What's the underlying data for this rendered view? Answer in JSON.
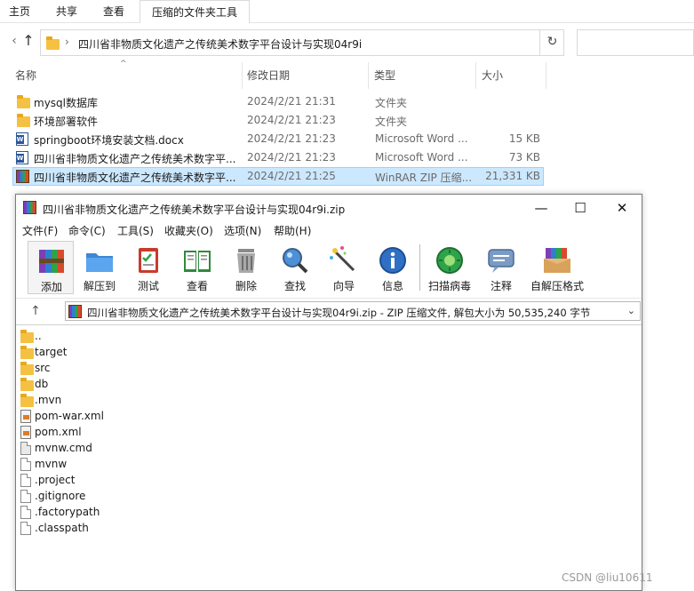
{
  "ribbon": {
    "tabs": [
      "主页",
      "共享",
      "查看",
      "压缩的文件夹工具"
    ]
  },
  "explorer": {
    "address_path": "四川省非物质文化遗产之传统美术数字平台设计与实现04r9i",
    "columns": [
      "名称",
      "修改日期",
      "类型",
      "大小"
    ],
    "files": [
      {
        "name": "mysql数据库",
        "date": "2024/2/21 21:31",
        "type": "文件夹",
        "size": "",
        "icon": "folder-icon"
      },
      {
        "name": "环境部署软件",
        "date": "2024/2/21 21:23",
        "type": "文件夹",
        "size": "",
        "icon": "folder-icon"
      },
      {
        "name": "springboot环境安装文档.docx",
        "date": "2024/2/21 21:23",
        "type": "Microsoft Word ...",
        "size": "15 KB",
        "icon": "word-doc-icon"
      },
      {
        "name": "四川省非物质文化遗产之传统美术数字平...",
        "date": "2024/2/21 21:23",
        "type": "Microsoft Word ...",
        "size": "73 KB",
        "icon": "word-doc-icon"
      },
      {
        "name": "四川省非物质文化遗产之传统美术数字平...",
        "date": "2024/2/21 21:25",
        "type": "WinRAR ZIP 压缩...",
        "size": "21,331 KB",
        "icon": "winrar-archive-icon",
        "selected": true
      }
    ]
  },
  "winrar": {
    "title": "四川省非物质文化遗产之传统美术数字平台设计与实现04r9i.zip",
    "menu": [
      "文件(F)",
      "命令(C)",
      "工具(S)",
      "收藏夹(O)",
      "选项(N)",
      "帮助(H)"
    ],
    "tools": [
      {
        "label": "添加",
        "icon": "add-archive-icon"
      },
      {
        "label": "解压到",
        "icon": "extract-to-icon"
      },
      {
        "label": "测试",
        "icon": "test-icon"
      },
      {
        "label": "查看",
        "icon": "view-book-icon"
      },
      {
        "label": "删除",
        "icon": "trash-icon"
      },
      {
        "label": "查找",
        "icon": "magnifier-icon"
      },
      {
        "label": "向导",
        "icon": "wizard-wand-icon"
      },
      {
        "label": "信息",
        "icon": "info-icon"
      },
      {
        "label": "扫描病毒",
        "icon": "virus-scan-icon"
      },
      {
        "label": "注释",
        "icon": "comment-icon"
      },
      {
        "label": "自解压格式",
        "icon": "sfx-box-icon"
      }
    ],
    "path_text": "四川省非物质文化遗产之传统美术数字平台设计与实现04r9i.zip - ZIP 压缩文件, 解包大小为 50,535,240 字节",
    "entries": [
      {
        "name": "..",
        "icon": "folder-icon"
      },
      {
        "name": "target",
        "icon": "folder-icon"
      },
      {
        "name": "src",
        "icon": "folder-icon"
      },
      {
        "name": "db",
        "icon": "folder-icon"
      },
      {
        "name": ".mvn",
        "icon": "folder-icon"
      },
      {
        "name": "pom-war.xml",
        "icon": "xml-file-icon"
      },
      {
        "name": "pom.xml",
        "icon": "xml-file-icon"
      },
      {
        "name": "mvnw.cmd",
        "icon": "cmd-file-icon"
      },
      {
        "name": "mvnw",
        "icon": "file-icon"
      },
      {
        "name": ".project",
        "icon": "file-icon"
      },
      {
        "name": ".gitignore",
        "icon": "file-icon"
      },
      {
        "name": ".factorypath",
        "icon": "file-icon"
      },
      {
        "name": ".classpath",
        "icon": "file-icon"
      }
    ]
  },
  "watermark": "CSDN @liu10611",
  "colors": {
    "selection_bg": "#cce8ff",
    "selection_border": "#99d1ff",
    "folder": "#f5c142",
    "word_blue": "#2b579a"
  }
}
